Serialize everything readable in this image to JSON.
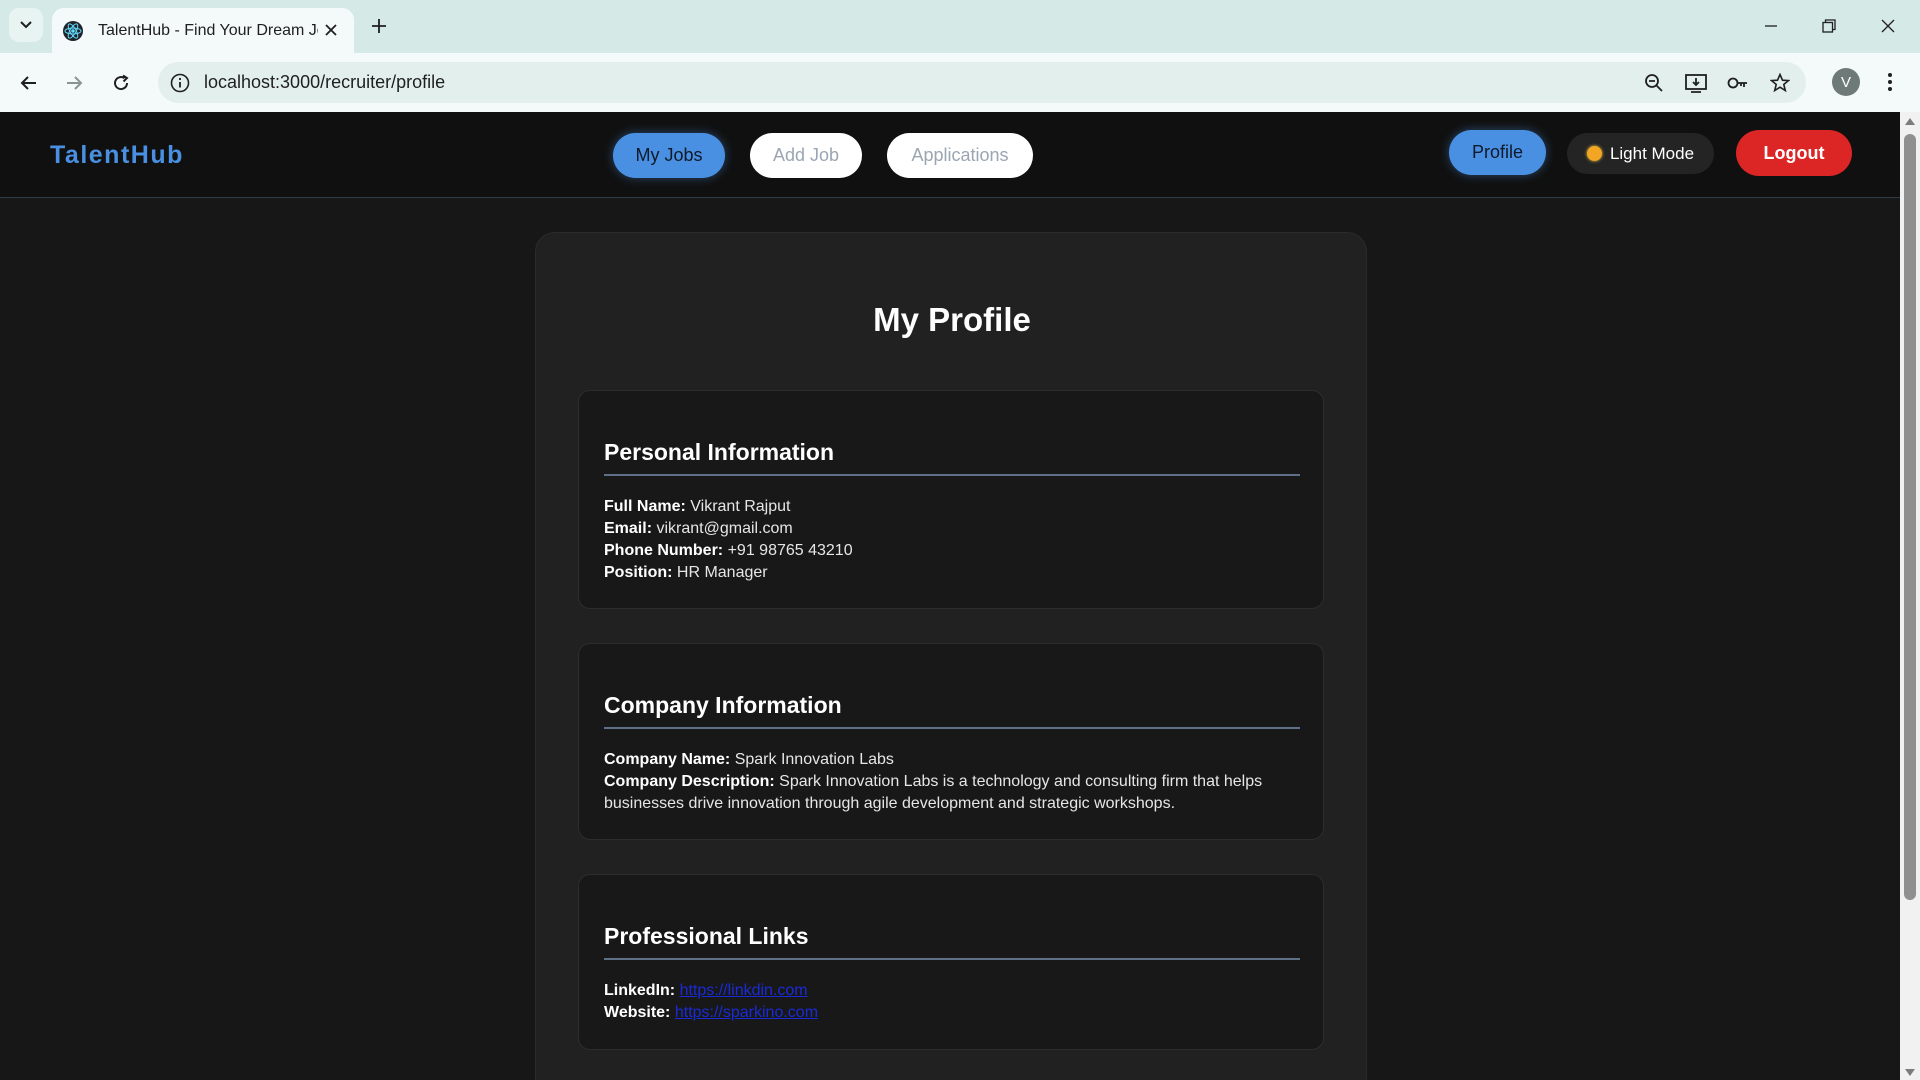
{
  "browser": {
    "tab_title": "TalentHub - Find Your Dream Jo",
    "url": "localhost:3000/recruiter/profile",
    "profile_initial": "V"
  },
  "navbar": {
    "brand": "TalentHub",
    "links": [
      {
        "label": "My Jobs",
        "active": true
      },
      {
        "label": "Add Job",
        "active": false
      },
      {
        "label": "Applications",
        "active": false
      }
    ],
    "profile_label": "Profile",
    "theme_label": "Light Mode",
    "logout_label": "Logout"
  },
  "profile": {
    "title": "My Profile",
    "personal": {
      "heading": "Personal Information",
      "full_name_label": "Full Name:",
      "full_name": "Vikrant Rajput",
      "email_label": "Email:",
      "email": "vikrant@gmail.com",
      "phone_label": "Phone Number:",
      "phone": "+91 98765 43210",
      "position_label": "Position:",
      "position": "HR Manager"
    },
    "company": {
      "heading": "Company Information",
      "name_label": "Company Name:",
      "name": "Spark Innovation Labs",
      "description_label": "Company Description:",
      "description": "Spark Innovation Labs is a technology and consulting firm that helps businesses drive innovation through agile development and strategic workshops."
    },
    "links": {
      "heading": "Professional Links",
      "linkedin_label": "LinkedIn:",
      "linkedin": "https://linkdin.com",
      "website_label": "Website:",
      "website": "https://sparkino.com"
    }
  },
  "colors": {
    "accent": "#4a90e2",
    "logout": "#dc2626",
    "background": "#171717"
  }
}
